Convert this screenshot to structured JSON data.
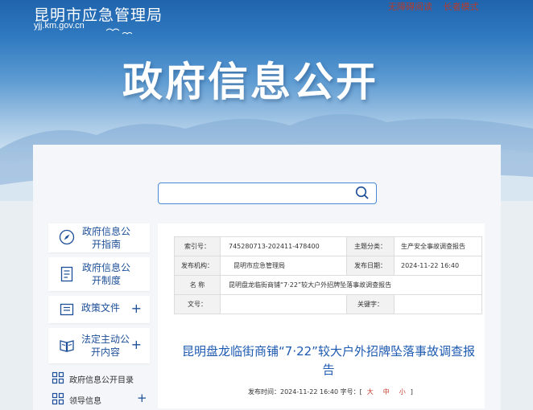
{
  "header": {
    "site_name": "昆明市应急管理局",
    "site_domain": "yjj.km.gov.cn",
    "top_links": [
      "无障碍阅读",
      "长者模式"
    ],
    "hero_title": "政府信息公开"
  },
  "search": {
    "placeholder": ""
  },
  "sidebar": {
    "items": [
      {
        "label": "政府信息公开指南",
        "icon": "compass-icon"
      },
      {
        "label": "政府信息公开制度",
        "icon": "document-icon"
      },
      {
        "label": "政策文件",
        "icon": "folder-icon",
        "expand": "+"
      },
      {
        "label": "法定主动公开内容",
        "icon": "book-icon",
        "expand": "+"
      }
    ],
    "small_items": [
      {
        "label": "政府信息公开目录",
        "icon": "grid-icon"
      },
      {
        "label": "领导信息",
        "icon": "grid-icon",
        "expand": "+"
      }
    ]
  },
  "meta": {
    "index_label": "索引号：",
    "index_value": "745280713-202411-478400",
    "topic_label": "主题分类：",
    "topic_value": "生产安全事故调查报告",
    "issuer_label": "发布机构：",
    "issuer_value": "昆明市应急管理局",
    "date_label": "发布日期：",
    "date_value": "2024-11-22 16:40",
    "name_label": "名 称",
    "name_value": "昆明盘龙临街商铺“7·22”较大户外招牌坠落事故调查报告",
    "docno_label": "文号：",
    "docno_value": "",
    "keyword_label": "关键字：",
    "keyword_value": ""
  },
  "article": {
    "title": "昆明盘龙临街商铺“7·22”较大户外招牌坠落事故调查报告",
    "pub_prefix": "发布时间：2024-11-22 16:40 字号：[",
    "size_large": "大",
    "size_medium": "中",
    "size_small": "小",
    "pub_suffix": "]"
  },
  "colors": {
    "accent": "#1d5ab0",
    "link_red": "#b43c2e"
  }
}
